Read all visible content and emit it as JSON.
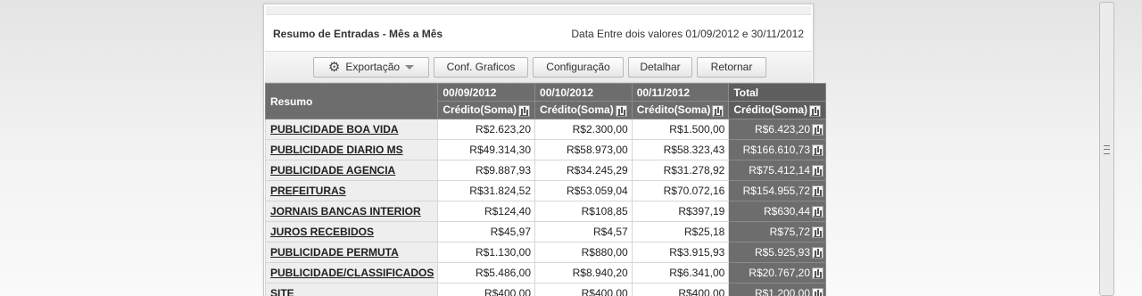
{
  "report": {
    "title": "Resumo de Entradas - Mês a Mês",
    "filter": "Data Entre dois valores 01/09/2012 e 30/11/2012"
  },
  "toolbar": {
    "export_label": "Exportação",
    "chart_config_label": "Conf. Graficos",
    "config_label": "Configuração",
    "detail_label": "Detalhar",
    "back_label": "Retornar"
  },
  "grid": {
    "row_header": "Resumo",
    "columns": [
      {
        "period": "00/09/2012",
        "measure": "Crédito(Soma)"
      },
      {
        "period": "00/10/2012",
        "measure": "Crédito(Soma)"
      },
      {
        "period": "00/11/2012",
        "measure": "Crédito(Soma)"
      },
      {
        "period": "Total",
        "measure": "Crédito(Soma)"
      }
    ],
    "rows": [
      {
        "label": "PUBLICIDADE BOA VIDA",
        "values": [
          "R$2.623,20",
          "R$2.300,00",
          "R$1.500,00",
          "R$6.423,20"
        ]
      },
      {
        "label": "PUBLICIDADE DIARIO MS",
        "values": [
          "R$49.314,30",
          "R$58.973,00",
          "R$58.323,43",
          "R$166.610,73"
        ]
      },
      {
        "label": "PUBLICIDADE AGENCIA",
        "values": [
          "R$9.887,93",
          "R$34.245,29",
          "R$31.278,92",
          "R$75.412,14"
        ]
      },
      {
        "label": "PREFEITURAS",
        "values": [
          "R$31.824,52",
          "R$53.059,04",
          "R$70.072,16",
          "R$154.955,72"
        ]
      },
      {
        "label": "JORNAIS BANCAS INTERIOR",
        "values": [
          "R$124,40",
          "R$108,85",
          "R$397,19",
          "R$630,44"
        ]
      },
      {
        "label": "JUROS RECEBIDOS",
        "values": [
          "R$45,97",
          "R$4,57",
          "R$25,18",
          "R$75,72"
        ]
      },
      {
        "label": "PUBLICIDADE PERMUTA",
        "values": [
          "R$1.130,00",
          "R$880,00",
          "R$3.915,93",
          "R$5.925,93"
        ]
      },
      {
        "label": "PUBLICIDADE/CLASSIFICADOS",
        "values": [
          "R$5.486,00",
          "R$8.940,20",
          "R$6.341,00",
          "R$20.767,20"
        ]
      },
      {
        "label": "SITE",
        "values": [
          "R$400,00",
          "R$400,00",
          "R$400,00",
          "R$1.200,00"
        ]
      }
    ]
  },
  "icons": {
    "export": "gear-icon",
    "dropdown": "chevron-down-icon",
    "chart": "bar-chart-icon"
  }
}
